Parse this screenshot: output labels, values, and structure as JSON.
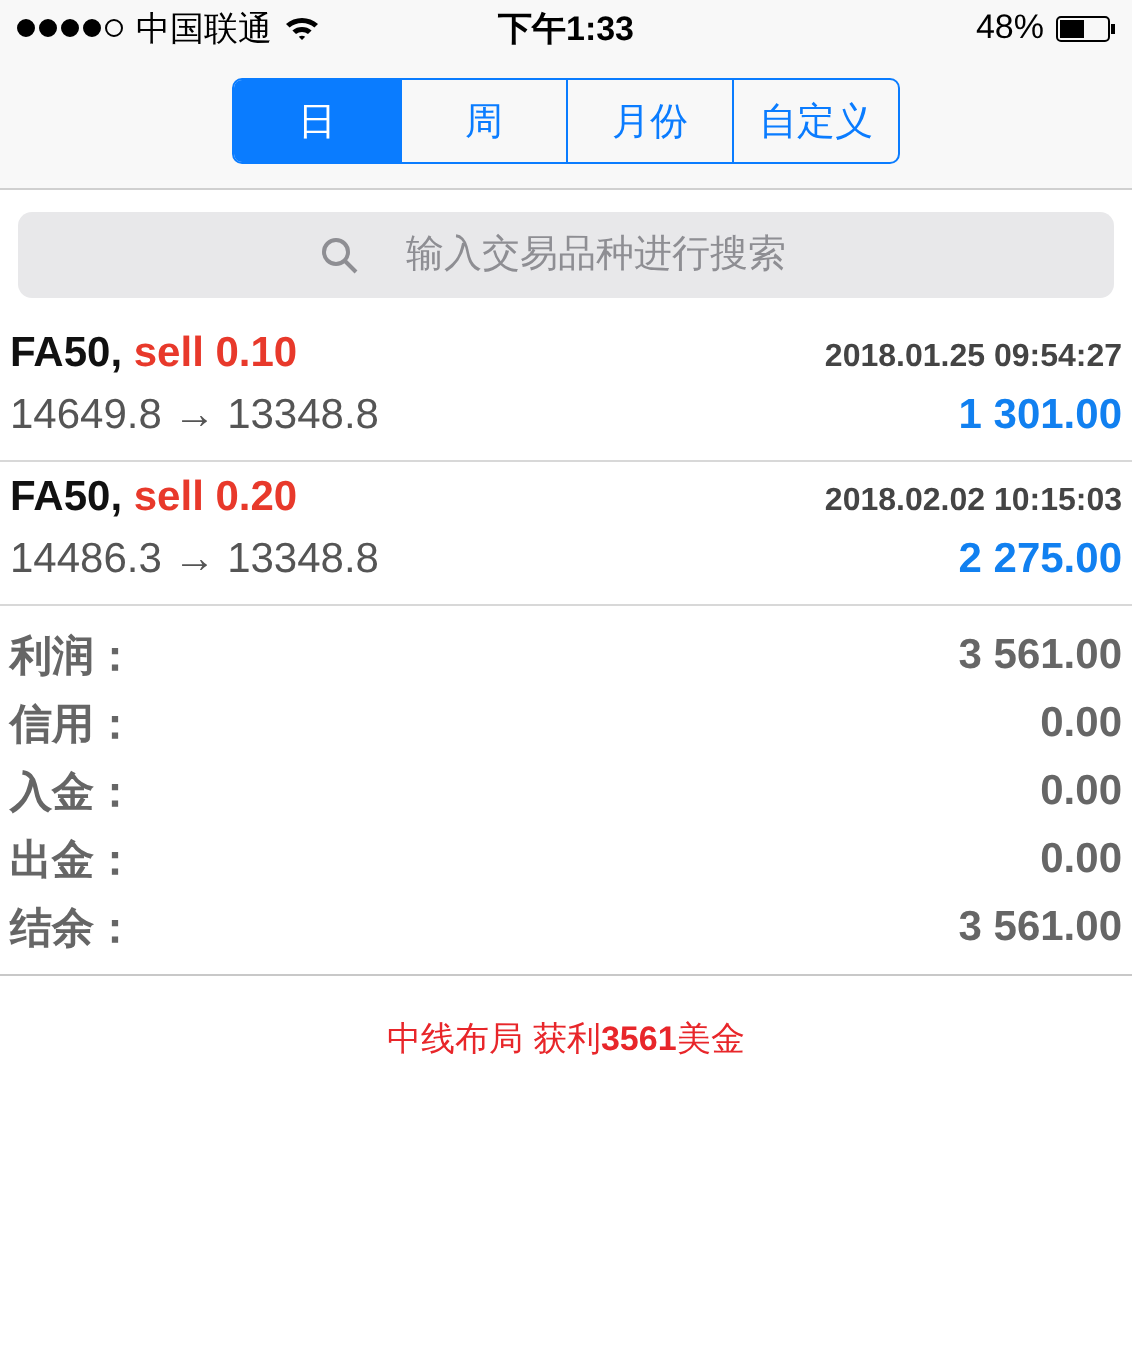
{
  "status_bar": {
    "carrier": "中国联通",
    "time": "下午1:33",
    "battery": "48%"
  },
  "tabs": [
    {
      "label": "日",
      "selected": true
    },
    {
      "label": "周",
      "selected": false
    },
    {
      "label": "月份",
      "selected": false
    },
    {
      "label": "自定义",
      "selected": false
    }
  ],
  "search": {
    "placeholder": "输入交易品种进行搜索"
  },
  "deals": [
    {
      "symbol": "FA50,",
      "order": "sell 0.10",
      "time": "2018.01.25 09:54:27",
      "prices": "14649.8 → 13348.8",
      "profit": "1 301.00"
    },
    {
      "symbol": "FA50,",
      "order": "sell 0.20",
      "time": "2018.02.02 10:15:03",
      "prices": "14486.3 → 13348.8",
      "profit": "2 275.00"
    }
  ],
  "summary": [
    {
      "label": "利润：",
      "value": "3 561.00"
    },
    {
      "label": "信用：",
      "value": "0.00"
    },
    {
      "label": "入金：",
      "value": "0.00"
    },
    {
      "label": "出金：",
      "value": "0.00"
    },
    {
      "label": "结余：",
      "value": "3 561.00"
    }
  ],
  "caption": "中线布局 获利**3561**美金"
}
